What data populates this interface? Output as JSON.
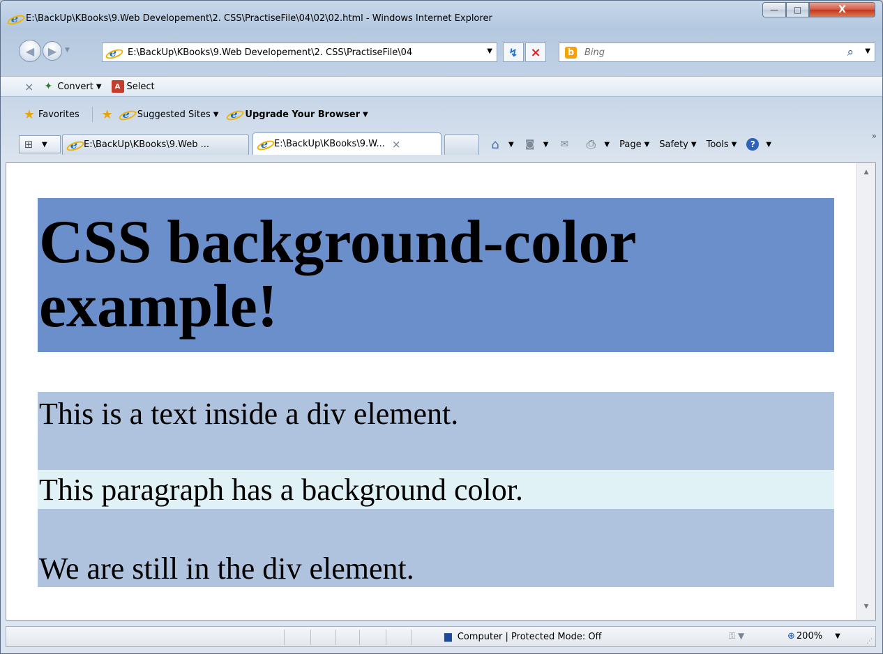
{
  "window": {
    "title": "E:\\BackUp\\KBooks\\9.Web Developement\\2. CSS\\PractiseFile\\04\\02\\02.html - Windows Internet Explorer",
    "minimize_glyph": "—",
    "maximize_glyph": "□",
    "close_glyph": "X"
  },
  "address_bar": {
    "url": "E:\\BackUp\\KBooks\\9.Web Developement\\2. CSS\\PractiseFile\\04",
    "go_glyph": "↯",
    "stop_glyph": "×"
  },
  "search": {
    "placeholder": "Bing",
    "logo_letter": "b"
  },
  "addon_bar": {
    "close_glyph": "×",
    "convert_label": "Convert",
    "select_label": "Select"
  },
  "favorites_bar": {
    "favorites_label": "Favorites",
    "suggested_sites_label": "Suggested Sites",
    "upgrade_label": "Upgrade Your Browser"
  },
  "tabs": [
    {
      "label": "E:\\BackUp\\KBooks\\9.Web ...",
      "active": false
    },
    {
      "label": "E:\\BackUp\\KBooks\\9.W...",
      "active": true,
      "close_glyph": "×"
    }
  ],
  "command_bar": {
    "page_label": "Page",
    "safety_label": "Safety",
    "tools_label": "Tools",
    "more_glyph": "»"
  },
  "content": {
    "h1_text": "CSS background-color example!",
    "h1_bg": "#6b8fca",
    "div_bg": "#b0c3de",
    "p_bg": "#e1f2f6",
    "div_line1": "This is a text inside a div element.",
    "p_text": "This paragraph has a background color.",
    "div_line3": "We are still in the div element."
  },
  "status_bar": {
    "zone_text": "Computer | Protected Mode: Off",
    "zoom_text": "200%"
  },
  "icons": {
    "ie": "ie-logo-icon",
    "back": "back-arrow-icon",
    "forward": "forward-arrow-icon",
    "search": "magnifier-icon",
    "home": "home-icon",
    "feeds": "rss-feed-icon",
    "mail": "mail-icon",
    "print": "printer-icon",
    "help": "help-icon",
    "computer": "computer-icon",
    "zoom": "zoom-icon"
  }
}
